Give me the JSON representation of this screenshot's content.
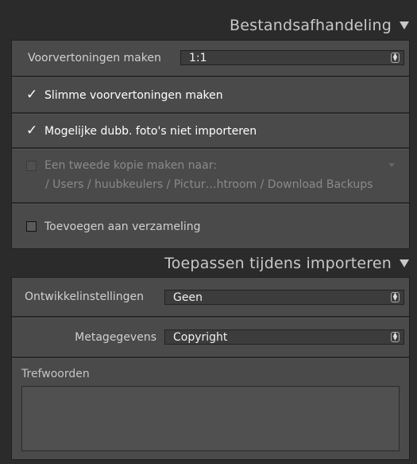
{
  "section1": {
    "title": "Bestandsafhandeling",
    "previews": {
      "label": "Voorvertoningen maken",
      "value": "1:1"
    },
    "smart_previews": {
      "label": "Slimme voorvertoningen maken",
      "checked": true
    },
    "no_duplicates": {
      "label": "Mogelijke dubb. foto's niet importeren",
      "checked": true
    },
    "second_copy": {
      "label": "Een tweede kopie maken naar:",
      "path": "/ Users / huubkeulers / Pictur…htroom / Download Backups",
      "checked": false
    },
    "add_collection": {
      "label": "Toevoegen aan verzameling",
      "checked": false
    }
  },
  "section2": {
    "title": "Toepassen tijdens importeren",
    "develop": {
      "label": "Ontwikkelinstellingen",
      "value": "Geen"
    },
    "metadata": {
      "label": "Metagegevens",
      "value": "Copyright"
    },
    "keywords": {
      "label": "Trefwoorden",
      "value": ""
    }
  }
}
